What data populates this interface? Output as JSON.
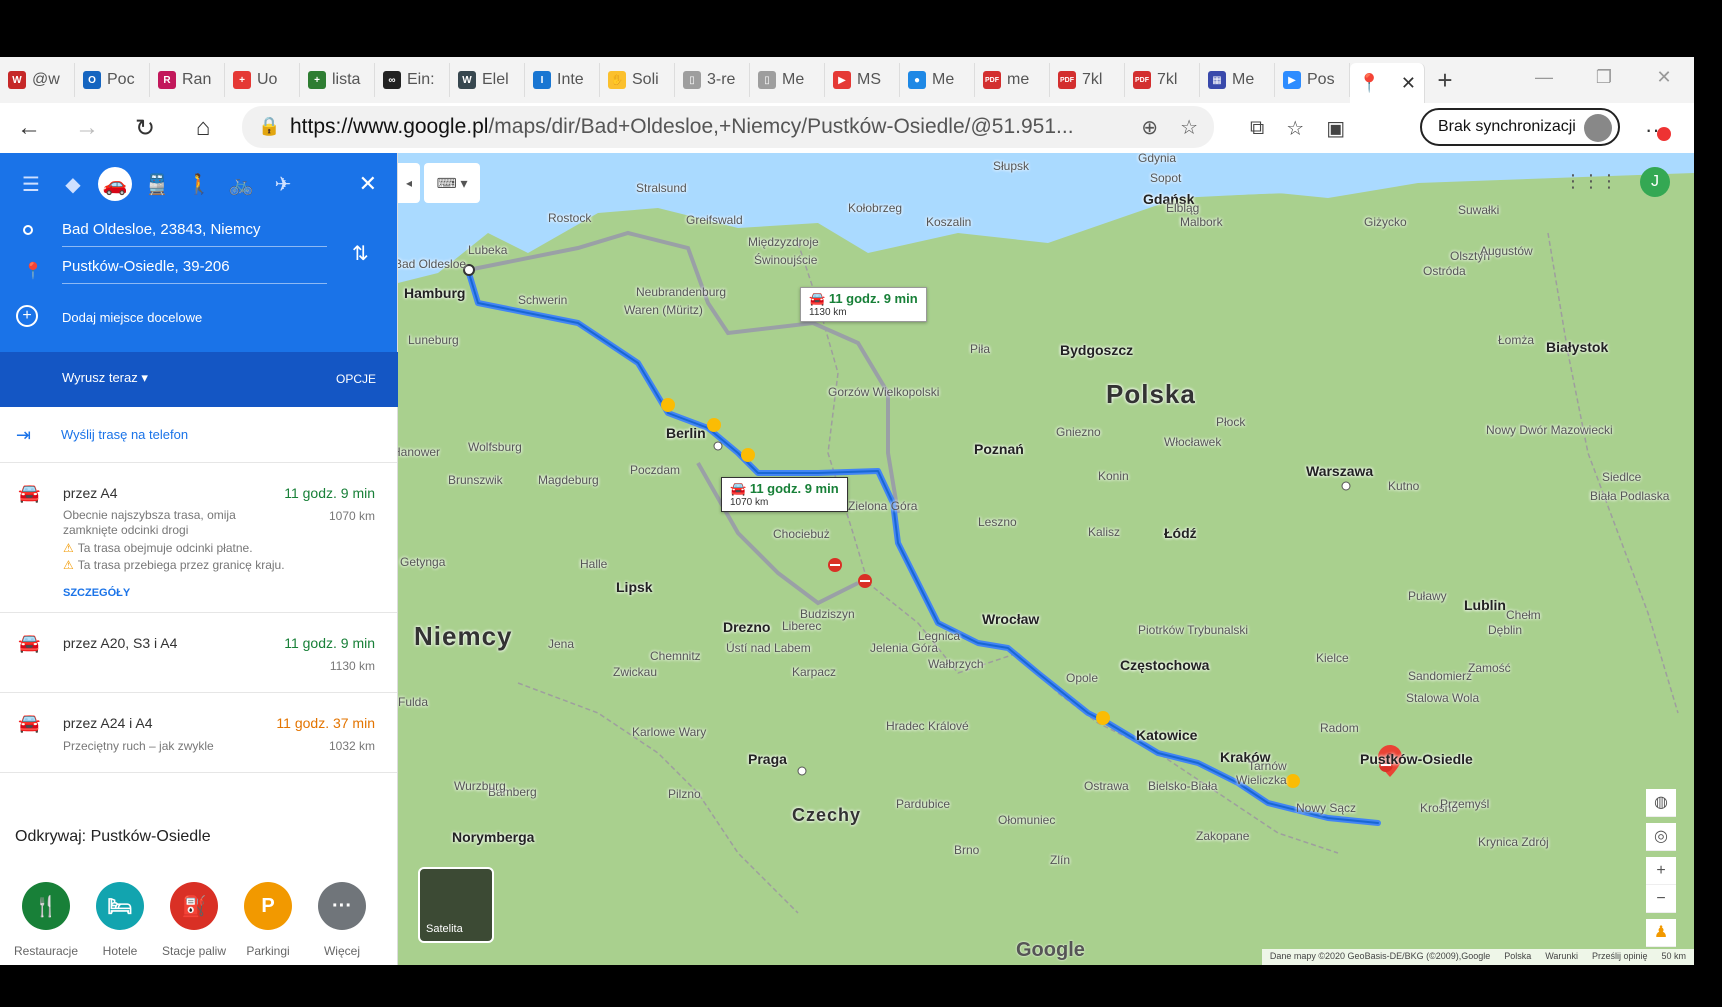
{
  "browser": {
    "tabs": [
      {
        "label": "@w",
        "fav_color": "#c62828",
        "fav_text": "W"
      },
      {
        "label": "Poc",
        "fav_color": "#1565c0",
        "fav_text": "O"
      },
      {
        "label": "Ran",
        "fav_color": "#c2185b",
        "fav_text": "R"
      },
      {
        "label": "Uo",
        "fav_color": "#e53935",
        "fav_text": "+"
      },
      {
        "label": "lista",
        "fav_color": "#2e7d32",
        "fav_text": "+"
      },
      {
        "label": "Ein:",
        "fav_color": "#222222",
        "fav_text": "∞"
      },
      {
        "label": "Elel",
        "fav_color": "#37474f",
        "fav_text": "W"
      },
      {
        "label": "Inte",
        "fav_color": "#1976d2",
        "fav_text": "I"
      },
      {
        "label": "Soli",
        "fav_color": "#fbc02d",
        "fav_text": "✋"
      },
      {
        "label": "3-re",
        "fav_color": "#9e9e9e",
        "fav_text": "▯"
      },
      {
        "label": "Me",
        "fav_color": "#9e9e9e",
        "fav_text": "▯"
      },
      {
        "label": "MS",
        "fav_color": "#e53935",
        "fav_text": "▶"
      },
      {
        "label": "Me",
        "fav_color": "#1e88e5",
        "fav_text": "●"
      },
      {
        "label": "me",
        "fav_color": "#d32f2f",
        "fav_text": "PDF"
      },
      {
        "label": "7kl",
        "fav_color": "#d32f2f",
        "fav_text": "PDF"
      },
      {
        "label": "7kl",
        "fav_color": "#d32f2f",
        "fav_text": "PDF"
      },
      {
        "label": "Me",
        "fav_color": "#3949ab",
        "fav_text": "▦"
      },
      {
        "label": "Pos",
        "fav_color": "#2d8cff",
        "fav_text": "▶"
      }
    ],
    "active_tab_icon": "google-maps-pin",
    "url_host": "https://www.google.pl",
    "url_path": "/maps/dir/Bad+Oldesloe,+Niemcy/Pustków-Osiedle/@51.951...",
    "sync_label": "Brak synchronizacji"
  },
  "panel": {
    "origin": "Bad Oldesloe, 23843, Niemcy",
    "destination": "Pustków-Osiedle, 39-206",
    "add_destination": "Dodaj miejsce docelowe",
    "depart": "Wyrusz teraz",
    "options": "OPCJE",
    "send_to_phone": "Wyślij trasę na telefon",
    "routes": [
      {
        "name": "przez A4",
        "time": "11 godz. 9 min",
        "distance": "1070 km",
        "desc": "Obecnie najszybsza trasa, omija zamknięte odcinki drogi",
        "warnings": [
          "Ta trasa obejmuje odcinki płatne.",
          "Ta trasa przebiega przez granicę kraju."
        ],
        "details": "SZCZEGÓŁY",
        "color": "#188038"
      },
      {
        "name": "przez A20, S3 i A4",
        "time": "11 godz. 9 min",
        "distance": "1130 km",
        "color": "#188038"
      },
      {
        "name": "przez A24 i A4",
        "time": "11 godz. 37 min",
        "distance": "1032 km",
        "desc": "Przeciętny ruch – jak zwykle",
        "color": "#e37400"
      }
    ],
    "explore_title": "Odkrywaj: Pustków-Osiedle",
    "categories": [
      {
        "label": "Restauracje",
        "color": "#188038",
        "icon": "fork-knife-icon"
      },
      {
        "label": "Hotele",
        "color": "#12a4af",
        "icon": "bed-icon"
      },
      {
        "label": "Stacje paliw",
        "color": "#d93025",
        "icon": "fuel-icon"
      },
      {
        "label": "Parkingi",
        "color": "#f29900",
        "icon": "parking-icon"
      },
      {
        "label": "Więcej",
        "color": "#70757a",
        "icon": "more-icon"
      }
    ]
  },
  "map": {
    "callout_alt": {
      "time": "11 godz. 9 min",
      "distance": "1130 km"
    },
    "callout_main": {
      "time": "11 godz. 9 min",
      "distance": "1070 km"
    },
    "satellite_label": "Satelita",
    "logo": "Google",
    "attribution": [
      "Dane mapy ©2020 GeoBasis-DE/BKG (©2009),Google",
      "Polska",
      "Warunki",
      "Prześlij opinię",
      "50 km"
    ],
    "countries": [
      "Polska",
      "Niemcy",
      "Czechy"
    ],
    "places": [
      "Gdynia",
      "Sopot",
      "Gdańsk",
      "Elbląg",
      "Słupsk",
      "Koszalin",
      "Kołobrzeg",
      "Rostock",
      "Stralsund",
      "Greifswald",
      "Lubeka",
      "Hamburg",
      "Schwerin",
      "Neubrandenburg",
      "Świnoujście",
      "Międzyzdroje",
      "Bad Oldesloe",
      "Luneburg",
      "Berlin",
      "Poczdam",
      "Wolfsburg",
      "Magdeburg",
      "Brunszwik",
      "Hanower",
      "Gorzów Wielkopolski",
      "Piła",
      "Bydgoszcz",
      "Poznań",
      "Gniezno",
      "Konin",
      "Włocławek",
      "Płock",
      "Warszawa",
      "Olsztyn",
      "Ostróda",
      "Malbork",
      "Giżycko",
      "Suwałki",
      "Augustów",
      "Białystok",
      "Siedlce",
      "Biała Podlaska",
      "Łódź",
      "Kalisz",
      "Leszno",
      "Zielona Góra",
      "Chociebuż",
      "Halle",
      "Lipsk",
      "Getynga",
      "Drezno",
      "Chemnitz",
      "Zwickau",
      "Jena",
      "Wrocław",
      "Legnica",
      "Jelenia Góra",
      "Wałbrzych",
      "Opole",
      "Częstochowa",
      "Katowice",
      "Kraków",
      "Tarnów",
      "Pustków-Osiedle",
      "Wieliczka",
      "Radom",
      "Lublin",
      "Kielce",
      "Sandomierz",
      "Stalowa Wola",
      "Zamość",
      "Chełm",
      "Puławy",
      "Piotrków Trybunalski",
      "Praga",
      "Pardubice",
      "Hradec Králové",
      "Ostrawa",
      "Bielsko-Biała",
      "Nowy Sącz",
      "Krosno",
      "Przemyśl",
      "Zakopane",
      "Brno",
      "Ołomuniec",
      "Norymberga",
      "Bamberg",
      "Wurzburg",
      "Pilzno",
      "Karlowe Wary",
      "Liberec",
      "Budziszyn",
      "Ústí nad Labem",
      "Fulda",
      "Łomża",
      "Nowy Dwór Mazowiecki",
      "Kutno",
      "Krynica Zdrój",
      "Zlín",
      "Waren (Müritz)",
      "Dęblin",
      "Karpacz"
    ]
  }
}
